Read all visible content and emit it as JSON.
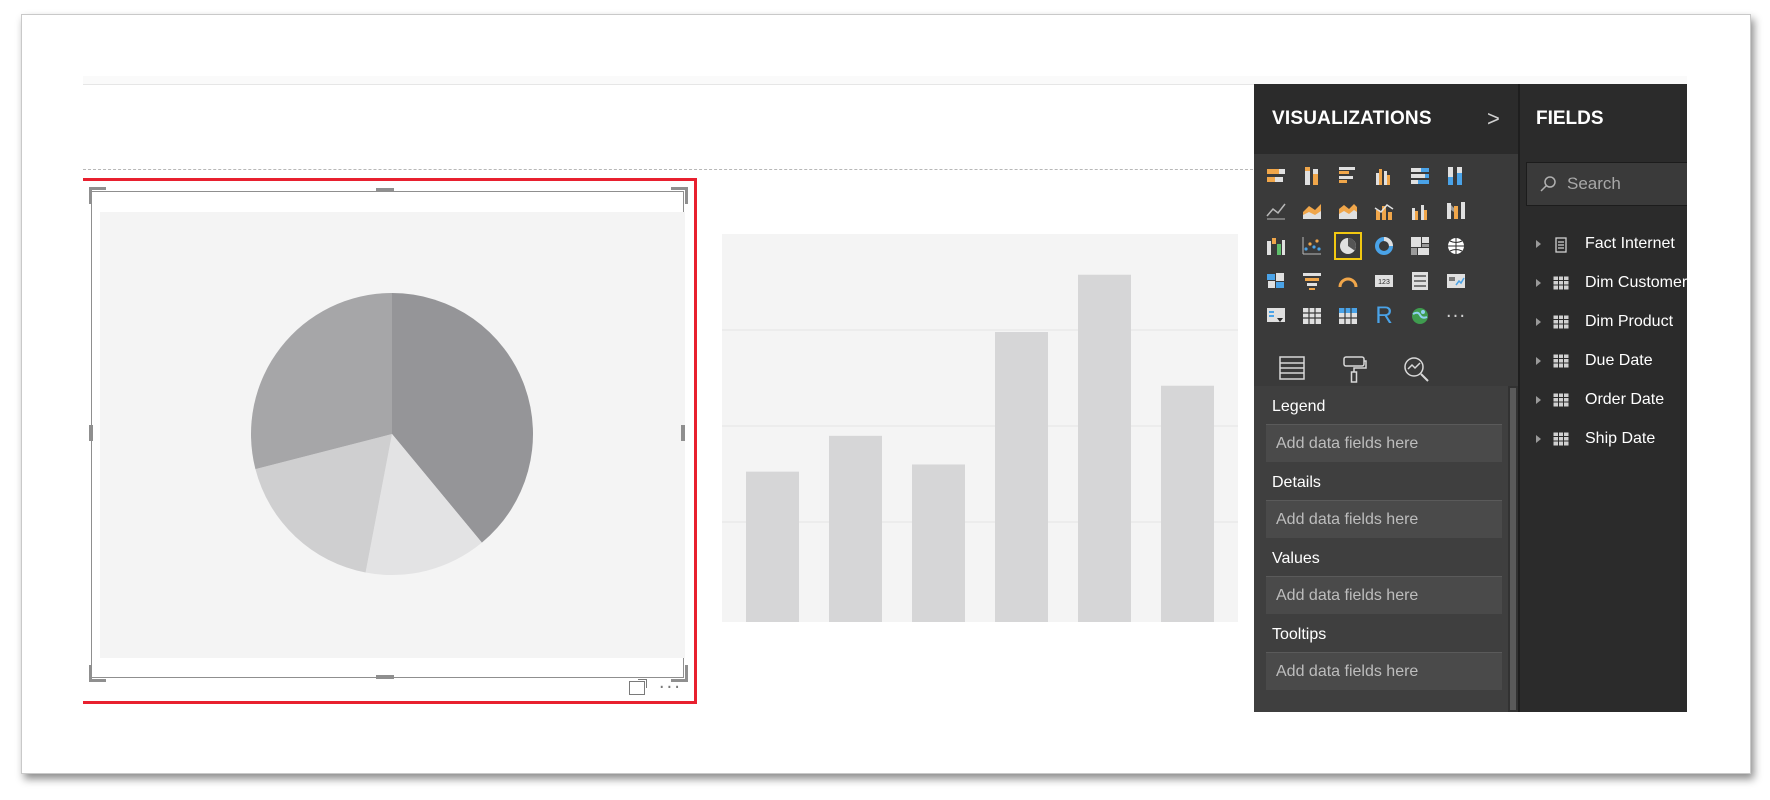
{
  "visualizations": {
    "title": "VISUALIZATIONS",
    "collapse_glyph": ">",
    "selected_icon": "pie-chart-icon",
    "icons": [
      "stacked-bar-icon",
      "stacked-column-icon",
      "clustered-bar-icon",
      "clustered-column-icon",
      "100pct-bar-icon",
      "100pct-column-icon",
      "line-chart-icon",
      "area-chart-icon",
      "stacked-area-icon",
      "line-column-icon",
      "line-clustered-column-icon",
      "ribbon-chart-icon",
      "waterfall-icon",
      "scatter-icon",
      "pie-chart-icon",
      "donut-chart-icon",
      "treemap-icon",
      "map-icon",
      "filled-map-icon",
      "funnel-icon",
      "gauge-icon",
      "card-icon",
      "multi-row-card-icon",
      "kpi-icon",
      "slicer-icon",
      "table-icon",
      "matrix-icon",
      "r-visual-icon",
      "globe-icon",
      "more-icon"
    ],
    "r_label": "R",
    "more_label": "···",
    "tabs": [
      "fields-tab-icon",
      "format-tab-icon",
      "analytics-tab-icon"
    ],
    "active_tab": "fields-tab-icon",
    "wells": [
      {
        "label": "Legend",
        "placeholder": "Add data fields here"
      },
      {
        "label": "Details",
        "placeholder": "Add data fields here"
      },
      {
        "label": "Values",
        "placeholder": "Add data fields here"
      },
      {
        "label": "Tooltips",
        "placeholder": "Add data fields here"
      }
    ]
  },
  "fields": {
    "title": "FIELDS",
    "search_placeholder": "Search",
    "items": [
      {
        "label": "Fact Internet",
        "icon": "fact-table-icon"
      },
      {
        "label": "Dim Customer",
        "icon": "table-icon"
      },
      {
        "label": "Dim Product",
        "icon": "table-icon"
      },
      {
        "label": "Due Date",
        "icon": "table-icon"
      },
      {
        "label": "Order Date",
        "icon": "table-icon"
      },
      {
        "label": "Ship Date",
        "icon": "table-icon"
      }
    ]
  },
  "pie_visual": {
    "footer_more": "···",
    "slice_shares": [
      0.39,
      0.14,
      0.18,
      0.29
    ],
    "slice_colors": [
      "#959598",
      "#e3e3e4",
      "#cfcfd0",
      "#a6a6a8"
    ]
  },
  "bar_visual": {
    "bar_values": [
      42,
      52,
      44,
      81,
      97,
      66
    ],
    "bar_color": "#d6d6d7",
    "grid_color": "#e3e3e3"
  },
  "colors": {
    "accent": "#f2c811",
    "selection_border": "#e8202f",
    "pane_bg": "#2b2b2b"
  }
}
